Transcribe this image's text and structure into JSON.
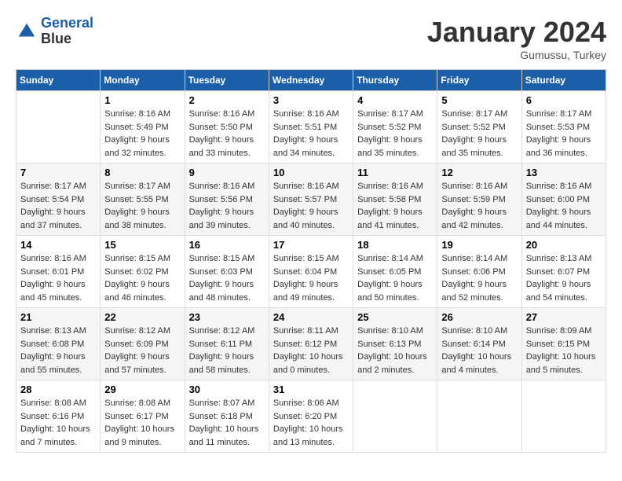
{
  "header": {
    "logo_line1": "General",
    "logo_line2": "Blue",
    "month": "January 2024",
    "location": "Gumussu, Turkey"
  },
  "weekdays": [
    "Sunday",
    "Monday",
    "Tuesday",
    "Wednesday",
    "Thursday",
    "Friday",
    "Saturday"
  ],
  "weeks": [
    [
      {
        "day": "",
        "sunrise": "",
        "sunset": "",
        "daylight": ""
      },
      {
        "day": "1",
        "sunrise": "Sunrise: 8:16 AM",
        "sunset": "Sunset: 5:49 PM",
        "daylight": "Daylight: 9 hours and 32 minutes."
      },
      {
        "day": "2",
        "sunrise": "Sunrise: 8:16 AM",
        "sunset": "Sunset: 5:50 PM",
        "daylight": "Daylight: 9 hours and 33 minutes."
      },
      {
        "day": "3",
        "sunrise": "Sunrise: 8:16 AM",
        "sunset": "Sunset: 5:51 PM",
        "daylight": "Daylight: 9 hours and 34 minutes."
      },
      {
        "day": "4",
        "sunrise": "Sunrise: 8:17 AM",
        "sunset": "Sunset: 5:52 PM",
        "daylight": "Daylight: 9 hours and 35 minutes."
      },
      {
        "day": "5",
        "sunrise": "Sunrise: 8:17 AM",
        "sunset": "Sunset: 5:52 PM",
        "daylight": "Daylight: 9 hours and 35 minutes."
      },
      {
        "day": "6",
        "sunrise": "Sunrise: 8:17 AM",
        "sunset": "Sunset: 5:53 PM",
        "daylight": "Daylight: 9 hours and 36 minutes."
      }
    ],
    [
      {
        "day": "7",
        "sunrise": "Sunrise: 8:17 AM",
        "sunset": "Sunset: 5:54 PM",
        "daylight": "Daylight: 9 hours and 37 minutes."
      },
      {
        "day": "8",
        "sunrise": "Sunrise: 8:17 AM",
        "sunset": "Sunset: 5:55 PM",
        "daylight": "Daylight: 9 hours and 38 minutes."
      },
      {
        "day": "9",
        "sunrise": "Sunrise: 8:16 AM",
        "sunset": "Sunset: 5:56 PM",
        "daylight": "Daylight: 9 hours and 39 minutes."
      },
      {
        "day": "10",
        "sunrise": "Sunrise: 8:16 AM",
        "sunset": "Sunset: 5:57 PM",
        "daylight": "Daylight: 9 hours and 40 minutes."
      },
      {
        "day": "11",
        "sunrise": "Sunrise: 8:16 AM",
        "sunset": "Sunset: 5:58 PM",
        "daylight": "Daylight: 9 hours and 41 minutes."
      },
      {
        "day": "12",
        "sunrise": "Sunrise: 8:16 AM",
        "sunset": "Sunset: 5:59 PM",
        "daylight": "Daylight: 9 hours and 42 minutes."
      },
      {
        "day": "13",
        "sunrise": "Sunrise: 8:16 AM",
        "sunset": "Sunset: 6:00 PM",
        "daylight": "Daylight: 9 hours and 44 minutes."
      }
    ],
    [
      {
        "day": "14",
        "sunrise": "Sunrise: 8:16 AM",
        "sunset": "Sunset: 6:01 PM",
        "daylight": "Daylight: 9 hours and 45 minutes."
      },
      {
        "day": "15",
        "sunrise": "Sunrise: 8:15 AM",
        "sunset": "Sunset: 6:02 PM",
        "daylight": "Daylight: 9 hours and 46 minutes."
      },
      {
        "day": "16",
        "sunrise": "Sunrise: 8:15 AM",
        "sunset": "Sunset: 6:03 PM",
        "daylight": "Daylight: 9 hours and 48 minutes."
      },
      {
        "day": "17",
        "sunrise": "Sunrise: 8:15 AM",
        "sunset": "Sunset: 6:04 PM",
        "daylight": "Daylight: 9 hours and 49 minutes."
      },
      {
        "day": "18",
        "sunrise": "Sunrise: 8:14 AM",
        "sunset": "Sunset: 6:05 PM",
        "daylight": "Daylight: 9 hours and 50 minutes."
      },
      {
        "day": "19",
        "sunrise": "Sunrise: 8:14 AM",
        "sunset": "Sunset: 6:06 PM",
        "daylight": "Daylight: 9 hours and 52 minutes."
      },
      {
        "day": "20",
        "sunrise": "Sunrise: 8:13 AM",
        "sunset": "Sunset: 6:07 PM",
        "daylight": "Daylight: 9 hours and 54 minutes."
      }
    ],
    [
      {
        "day": "21",
        "sunrise": "Sunrise: 8:13 AM",
        "sunset": "Sunset: 6:08 PM",
        "daylight": "Daylight: 9 hours and 55 minutes."
      },
      {
        "day": "22",
        "sunrise": "Sunrise: 8:12 AM",
        "sunset": "Sunset: 6:09 PM",
        "daylight": "Daylight: 9 hours and 57 minutes."
      },
      {
        "day": "23",
        "sunrise": "Sunrise: 8:12 AM",
        "sunset": "Sunset: 6:11 PM",
        "daylight": "Daylight: 9 hours and 58 minutes."
      },
      {
        "day": "24",
        "sunrise": "Sunrise: 8:11 AM",
        "sunset": "Sunset: 6:12 PM",
        "daylight": "Daylight: 10 hours and 0 minutes."
      },
      {
        "day": "25",
        "sunrise": "Sunrise: 8:10 AM",
        "sunset": "Sunset: 6:13 PM",
        "daylight": "Daylight: 10 hours and 2 minutes."
      },
      {
        "day": "26",
        "sunrise": "Sunrise: 8:10 AM",
        "sunset": "Sunset: 6:14 PM",
        "daylight": "Daylight: 10 hours and 4 minutes."
      },
      {
        "day": "27",
        "sunrise": "Sunrise: 8:09 AM",
        "sunset": "Sunset: 6:15 PM",
        "daylight": "Daylight: 10 hours and 5 minutes."
      }
    ],
    [
      {
        "day": "28",
        "sunrise": "Sunrise: 8:08 AM",
        "sunset": "Sunset: 6:16 PM",
        "daylight": "Daylight: 10 hours and 7 minutes."
      },
      {
        "day": "29",
        "sunrise": "Sunrise: 8:08 AM",
        "sunset": "Sunset: 6:17 PM",
        "daylight": "Daylight: 10 hours and 9 minutes."
      },
      {
        "day": "30",
        "sunrise": "Sunrise: 8:07 AM",
        "sunset": "Sunset: 6:18 PM",
        "daylight": "Daylight: 10 hours and 11 minutes."
      },
      {
        "day": "31",
        "sunrise": "Sunrise: 8:06 AM",
        "sunset": "Sunset: 6:20 PM",
        "daylight": "Daylight: 10 hours and 13 minutes."
      },
      {
        "day": "",
        "sunrise": "",
        "sunset": "",
        "daylight": ""
      },
      {
        "day": "",
        "sunrise": "",
        "sunset": "",
        "daylight": ""
      },
      {
        "day": "",
        "sunrise": "",
        "sunset": "",
        "daylight": ""
      }
    ]
  ]
}
